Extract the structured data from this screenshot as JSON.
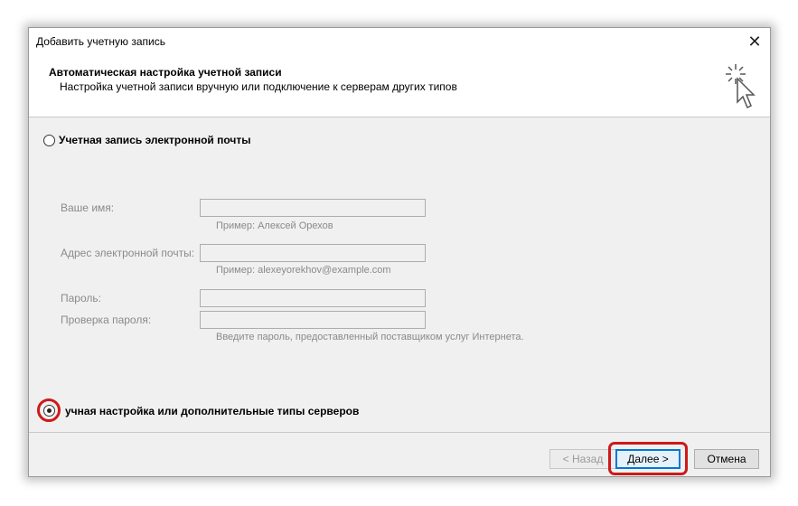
{
  "window": {
    "title": "Добавить учетную запись"
  },
  "header": {
    "title": "Автоматическая настройка учетной записи",
    "subtitle": "Настройка учетной записи вручную или подключение к серверам других типов",
    "icon": "cursor-sparkle-icon"
  },
  "options": {
    "email_account_label": "Учетная запись электронной почты",
    "email_account_selected": false,
    "manual_setup_label": "учная настройка или дополнительные типы серверов",
    "manual_setup_selected": true
  },
  "form": {
    "name_label": "Ваше имя:",
    "name_value": "",
    "name_hint": "Пример: Алексей Орехов",
    "email_label": "Адрес электронной почты:",
    "email_value": "",
    "email_hint": "Пример: alexeyorekhov@example.com",
    "password_label": "Пароль:",
    "password_value": "",
    "confirm_label": "Проверка пароля:",
    "confirm_value": "",
    "password_hint": "Введите пароль, предоставленный поставщиком услуг Интернета."
  },
  "buttons": {
    "back": "< Назад",
    "next": "Далее >",
    "cancel": "Отмена"
  },
  "colors": {
    "highlight": "#cc1a1a",
    "focus": "#0078d7"
  }
}
